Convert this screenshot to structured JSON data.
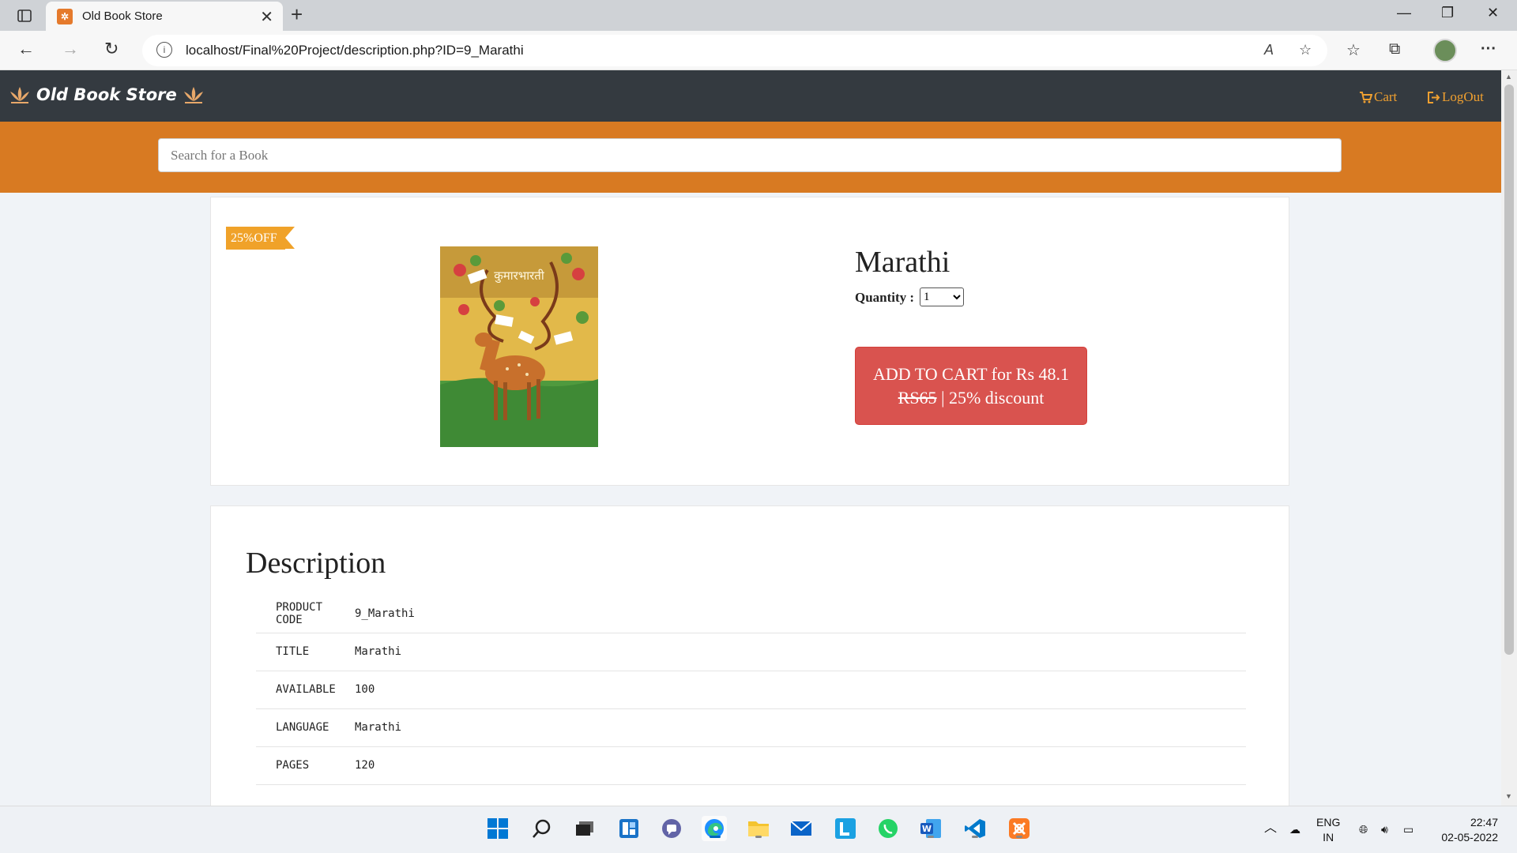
{
  "browser": {
    "tab_title": "Old Book Store",
    "url": "localhost/Final%20Project/description.php?ID=9_Marathi"
  },
  "site": {
    "brand": "Old Book Store",
    "nav": {
      "cart": "Cart",
      "logout": "LogOut"
    },
    "search_placeholder": "Search for a Book"
  },
  "product": {
    "badge": "25%OFF",
    "cover_title": "कुमारभारती",
    "title": "Marathi",
    "quantity_label": "Quantity :",
    "quantity_value": "1",
    "add_to_cart_line1": "ADD TO CART for Rs 48.1",
    "old_price": "RS65",
    "discount_text": " | 25% discount"
  },
  "description": {
    "heading": "Description",
    "rows": [
      {
        "key": "PRODUCT CODE",
        "value": "9_Marathi"
      },
      {
        "key": "TITLE",
        "value": "Marathi"
      },
      {
        "key": "AVAILABLE",
        "value": "100"
      },
      {
        "key": "LANGUAGE",
        "value": "Marathi"
      },
      {
        "key": "PAGES",
        "value": "120"
      }
    ]
  },
  "taskbar": {
    "lang_line1": "ENG",
    "lang_line2": "IN",
    "time": "22:47",
    "date": "02-05-2022"
  },
  "colors": {
    "navbar": "#343a40",
    "search_band": "#d87a22",
    "cart_button": "#d9534f",
    "badge": "#f0a229",
    "nav_link": "#f0a030"
  }
}
